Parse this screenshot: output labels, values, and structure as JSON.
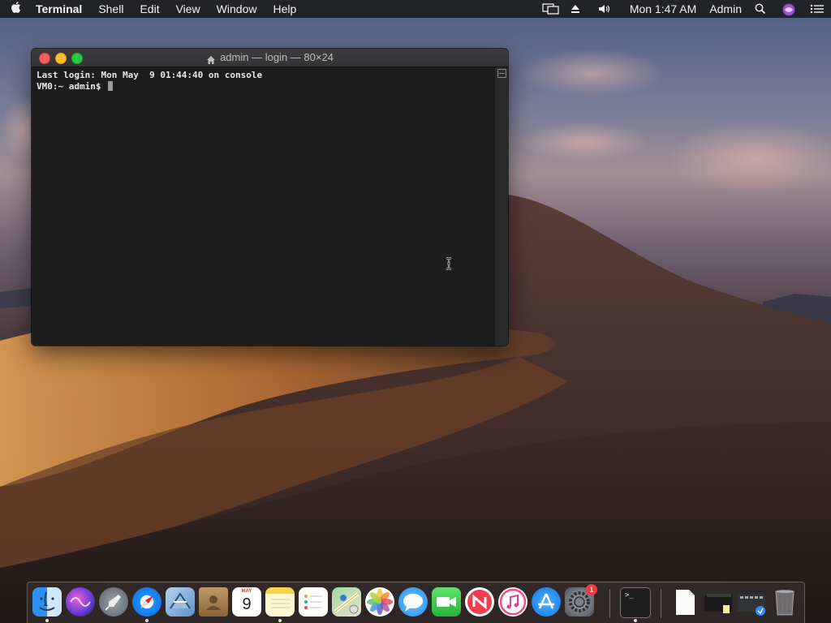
{
  "menubar": {
    "apple_icon": "apple-logo-icon",
    "app_name": "Terminal",
    "menus": [
      "Shell",
      "Edit",
      "View",
      "Window",
      "Help"
    ],
    "clock": "Mon 1:47 AM",
    "user": "Admin",
    "status_icons": [
      "display-mirroring-icon",
      "eject-icon",
      "volume-icon",
      "search-icon",
      "siri-icon",
      "notification-center-icon"
    ]
  },
  "terminal": {
    "title": "admin — login — 80×24",
    "lines": [
      "Last login: Mon May  9 01:44:40 on console",
      "VM0:~ admin$ "
    ]
  },
  "dock": {
    "items": [
      {
        "name": "finder",
        "running": true
      },
      {
        "name": "siri",
        "running": false
      },
      {
        "name": "launchpad",
        "running": false
      },
      {
        "name": "safari",
        "running": true
      },
      {
        "name": "mail",
        "running": false
      },
      {
        "name": "contacts",
        "running": false
      },
      {
        "name": "calendar",
        "running": false,
        "month": "MAY",
        "day": "9"
      },
      {
        "name": "notes",
        "running": true
      },
      {
        "name": "reminders",
        "running": false
      },
      {
        "name": "maps",
        "running": false
      },
      {
        "name": "photos",
        "running": false
      },
      {
        "name": "messages",
        "running": false
      },
      {
        "name": "facetime",
        "running": false
      },
      {
        "name": "news",
        "running": false
      },
      {
        "name": "itunes",
        "running": false
      },
      {
        "name": "app-store",
        "running": false
      },
      {
        "name": "system-preferences",
        "running": false,
        "badge": "1"
      },
      {
        "name": "terminal",
        "running": true,
        "prompt": ">_"
      },
      {
        "name": "document",
        "running": false
      },
      {
        "name": "preview-stack",
        "running": false
      },
      {
        "name": "downloads-stack",
        "running": false
      },
      {
        "name": "trash",
        "running": false
      }
    ]
  }
}
